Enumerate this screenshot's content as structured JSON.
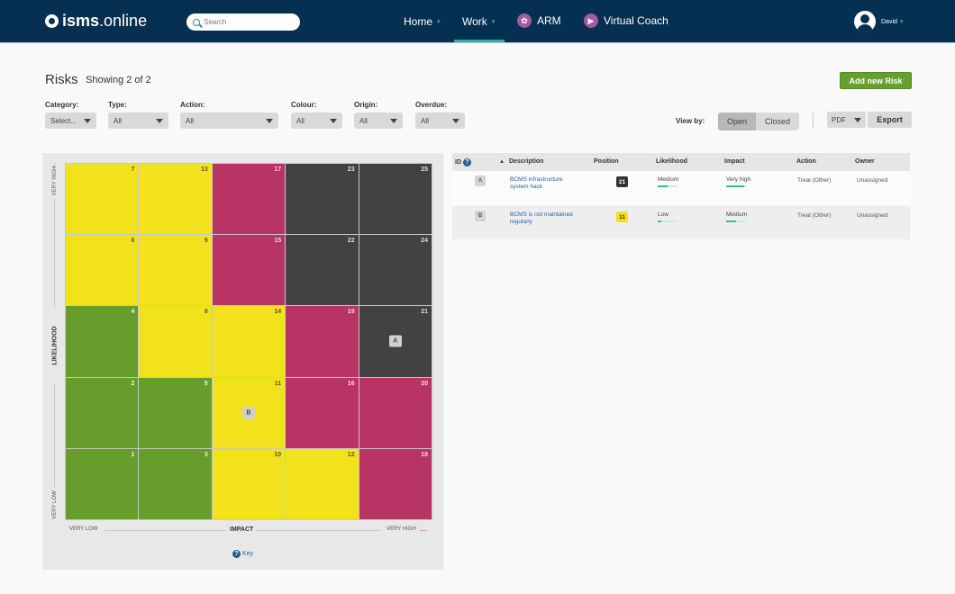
{
  "header": {
    "logo_bold": "isms",
    "logo_rest": ".online",
    "search_placeholder": "Search",
    "nav": [
      {
        "label": "Home",
        "caret": "▾",
        "active": false
      },
      {
        "label": "Work",
        "caret": "▾",
        "active": true
      },
      {
        "label": "ARM",
        "icon": "arm-icon"
      },
      {
        "label": "Virtual Coach",
        "icon": "virtual-coach-icon"
      }
    ],
    "user": {
      "name": "David",
      "caret": "▾"
    }
  },
  "page": {
    "title": "Risks",
    "count": "Showing 2 of 2",
    "add_button": "Add new Risk"
  },
  "filters": [
    {
      "label": "Category:",
      "value": "Select..."
    },
    {
      "label": "Type:",
      "value": "All"
    },
    {
      "label": "Action:",
      "value": "All"
    },
    {
      "label": "Colour:",
      "value": "All"
    },
    {
      "label": "Origin:",
      "value": "All"
    },
    {
      "label": "Overdue:",
      "value": "All"
    }
  ],
  "view_by": {
    "label": "View by:",
    "options": [
      "Open",
      "Closed"
    ],
    "selected": "Open"
  },
  "export": {
    "format": "PDF",
    "button": "Export"
  },
  "matrix": {
    "y_axis": {
      "label": "LIKELIHOOD",
      "low": "VERY LOW",
      "high": "VERY HIGH"
    },
    "x_axis": {
      "label": "IMPACT",
      "low": "VERY LOW",
      "high": "VERY HIGH"
    },
    "key_label": "Key",
    "colors": {
      "green": "#669d2b",
      "yellow": "#f1e21b",
      "red": "#b83465",
      "black": "#424242"
    },
    "rows": [
      [
        {
          "n": "7",
          "c": "yellow"
        },
        {
          "n": "13",
          "c": "yellow"
        },
        {
          "n": "17",
          "c": "red"
        },
        {
          "n": "23",
          "c": "black"
        },
        {
          "n": "25",
          "c": "black"
        }
      ],
      [
        {
          "n": "6",
          "c": "yellow"
        },
        {
          "n": "9",
          "c": "yellow"
        },
        {
          "n": "15",
          "c": "red"
        },
        {
          "n": "22",
          "c": "black"
        },
        {
          "n": "24",
          "c": "black"
        }
      ],
      [
        {
          "n": "4",
          "c": "green"
        },
        {
          "n": "8",
          "c": "yellow"
        },
        {
          "n": "14",
          "c": "yellow"
        },
        {
          "n": "19",
          "c": "red"
        },
        {
          "n": "21",
          "c": "black",
          "marker": "A"
        }
      ],
      [
        {
          "n": "2",
          "c": "green"
        },
        {
          "n": "5",
          "c": "green"
        },
        {
          "n": "11",
          "c": "yellow",
          "marker": "B"
        },
        {
          "n": "16",
          "c": "red"
        },
        {
          "n": "20",
          "c": "red"
        }
      ],
      [
        {
          "n": "1",
          "c": "green"
        },
        {
          "n": "3",
          "c": "green"
        },
        {
          "n": "10",
          "c": "yellow"
        },
        {
          "n": "12",
          "c": "yellow"
        },
        {
          "n": "18",
          "c": "red"
        }
      ]
    ]
  },
  "table": {
    "columns": {
      "id": "ID",
      "sort_arrow": "▲",
      "description": "Description",
      "position": "Position",
      "likelihood": "Likelihood",
      "impact": "Impact",
      "action": "Action",
      "owner": "Owner"
    },
    "rows": [
      {
        "id": "A",
        "description": "BCMS infrastructure system hack",
        "position": "21",
        "position_color": "black",
        "likelihood": "Medium",
        "likelihood_level": 0.5,
        "impact": "Very high",
        "impact_level": 0.9,
        "action": "Treat (Other)",
        "owner": "Unassigned"
      },
      {
        "id": "B",
        "description": "BCMS is not maintained regularly",
        "position": "11",
        "position_color": "yellow",
        "likelihood": "Low",
        "likelihood_level": 0.2,
        "impact": "Medium",
        "impact_level": 0.5,
        "action": "Treat (Other)",
        "owner": "Unassigned"
      }
    ]
  }
}
